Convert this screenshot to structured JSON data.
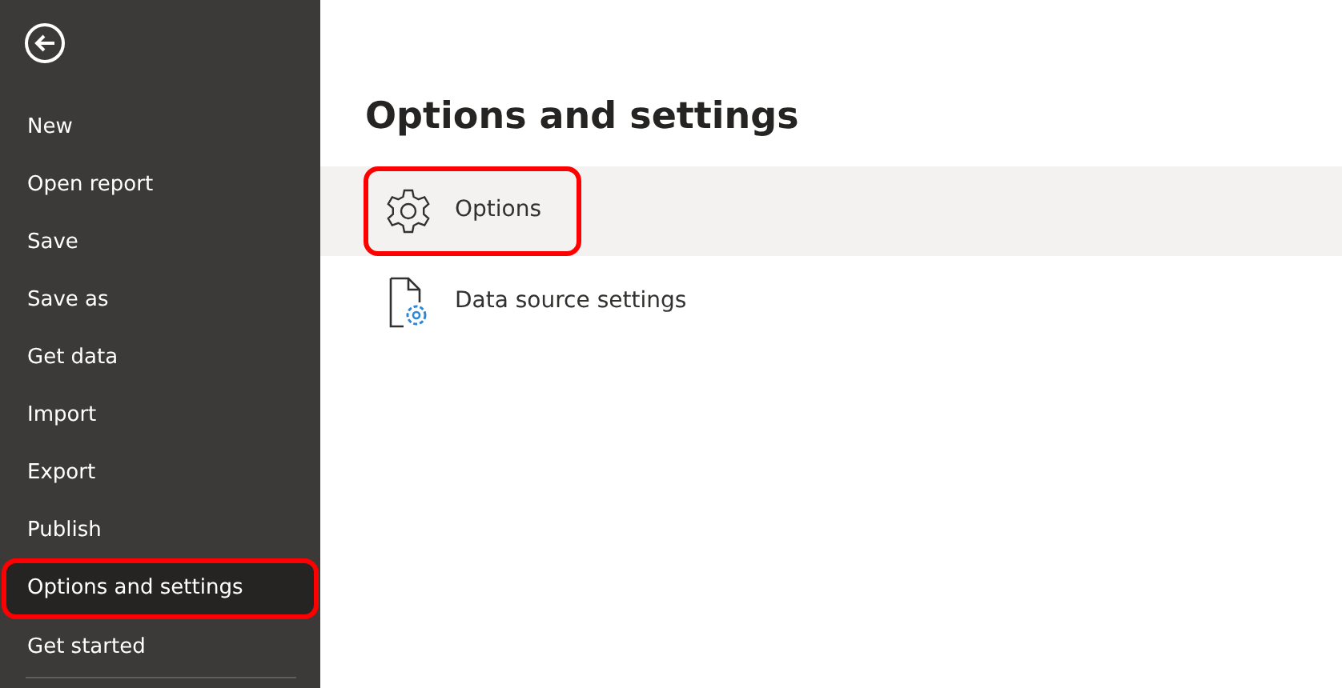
{
  "sidebar": {
    "items": [
      {
        "label": "New",
        "selected": false,
        "highlighted": false
      },
      {
        "label": "Open report",
        "selected": false,
        "highlighted": false
      },
      {
        "label": "Save",
        "selected": false,
        "highlighted": false
      },
      {
        "label": "Save as",
        "selected": false,
        "highlighted": false
      },
      {
        "label": "Get data",
        "selected": false,
        "highlighted": false
      },
      {
        "label": "Import",
        "selected": false,
        "highlighted": false
      },
      {
        "label": "Export",
        "selected": false,
        "highlighted": false
      },
      {
        "label": "Publish",
        "selected": false,
        "highlighted": false
      },
      {
        "label": "Options and settings",
        "selected": true,
        "highlighted": true
      },
      {
        "label": "Get started",
        "selected": false,
        "highlighted": false
      }
    ]
  },
  "main": {
    "title": "Options and settings",
    "items": [
      {
        "kind": "gear",
        "label": "Options",
        "selected": true,
        "highlighted": true
      },
      {
        "kind": "document",
        "label": "Data source settings",
        "selected": false,
        "highlighted": false
      }
    ]
  }
}
